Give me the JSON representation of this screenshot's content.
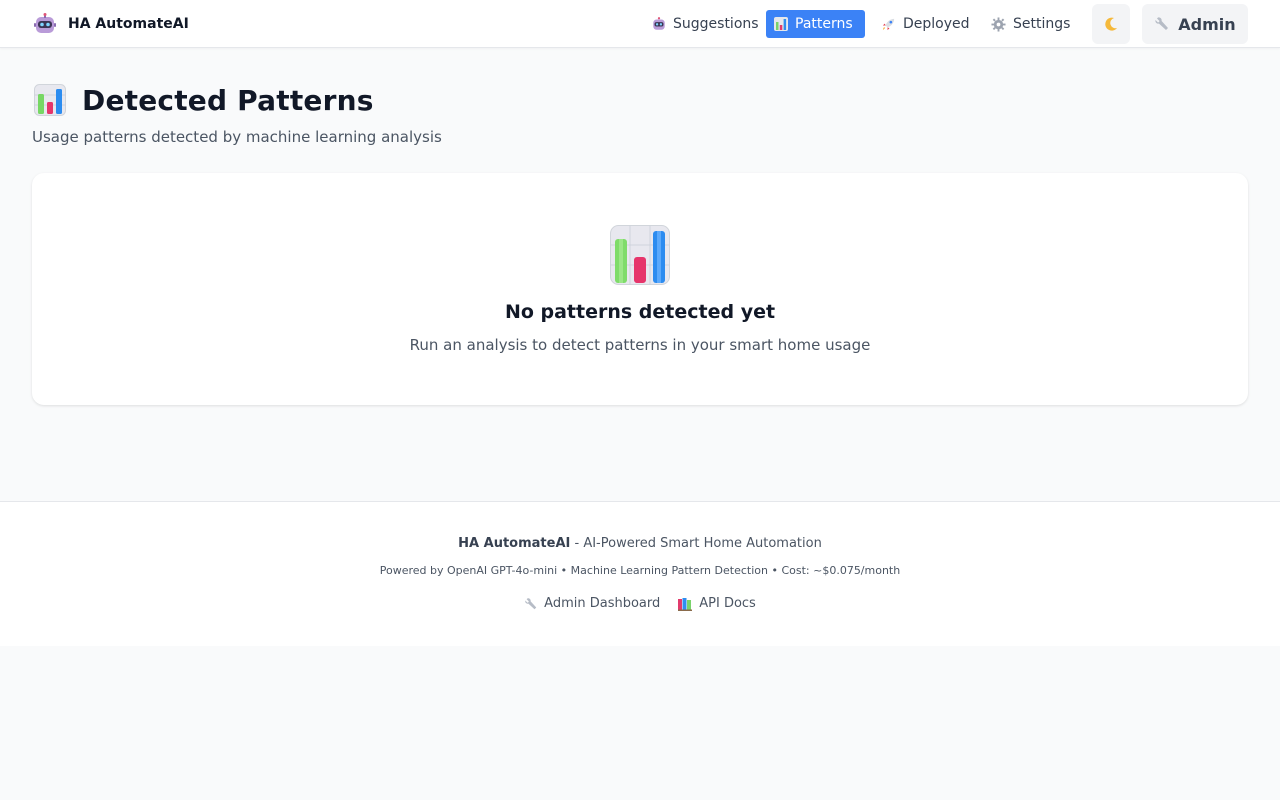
{
  "app": {
    "name": "HA AutomateAI",
    "logo_icon": "robot-icon"
  },
  "nav": {
    "items": [
      {
        "label": "Suggestions",
        "icon": "robot-icon",
        "active": false
      },
      {
        "label": "Patterns",
        "icon": "bar-chart-icon",
        "active": true
      },
      {
        "label": "Deployed",
        "icon": "rocket-icon",
        "active": false
      },
      {
        "label": "Settings",
        "icon": "gear-icon",
        "active": false
      }
    ],
    "theme_toggle_icon": "moon-icon",
    "admin_label": "Admin",
    "admin_icon": "wrench-icon"
  },
  "page": {
    "title": "Detected Patterns",
    "title_icon": "bar-chart-icon",
    "subtitle": "Usage patterns detected by machine learning analysis"
  },
  "empty_state": {
    "icon": "bar-chart-icon",
    "title": "No patterns detected yet",
    "text": "Run an analysis to detect patterns in your smart home usage"
  },
  "footer": {
    "brand": "HA AutomateAI",
    "tagline": " - AI-Powered Smart Home Automation",
    "powered_by": "Powered by OpenAI GPT-4o-mini • Machine Learning Pattern Detection • Cost: ~$0.075/month",
    "links": [
      {
        "label": "Admin Dashboard",
        "icon": "wrench-icon"
      },
      {
        "label": "API Docs",
        "icon": "books-icon"
      }
    ]
  },
  "colors": {
    "accent": "#3b82f6",
    "background": "#f9fafb",
    "card": "#ffffff",
    "text": "#111827",
    "muted": "#4b5563"
  }
}
